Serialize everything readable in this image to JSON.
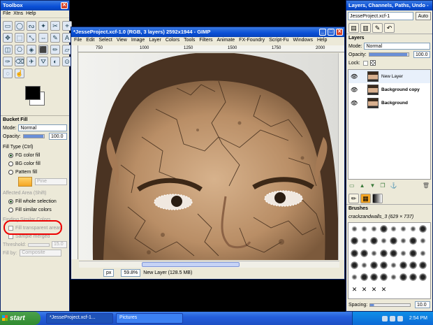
{
  "toolbox": {
    "title": "Toolbox",
    "menu": [
      "File",
      "Xtns",
      "Help"
    ],
    "tools": [
      "▭",
      "◯",
      "ᔓ",
      "✦",
      "✂",
      "⌖",
      "✥",
      "⬚",
      "⤡",
      "⇔",
      "✎",
      "A",
      "◫",
      "⎔",
      "◈",
      "⬛",
      "✏",
      "▱",
      "✑",
      "⌫",
      "✈",
      "⛛",
      "◐",
      "⊙",
      "◌",
      "☝"
    ],
    "tool_options_title": "Bucket Fill",
    "mode_label": "Mode:",
    "mode_value": "Normal",
    "opacity_label": "Opacity:",
    "opacity_value": "100.0",
    "fill_type_label": "Fill Type  (Ctrl)",
    "fill_fg": "FG color fill",
    "fill_bg": "BG color fill",
    "fill_pattern": "Pattern fill",
    "pattern_name": "Pine",
    "affected_area_label": "Affected Area  (Shift)",
    "fill_whole": "Fill whole selection",
    "fill_similar": "Fill similar colors",
    "finding_label": "Finding Similar Colors",
    "fill_transparent": "Fill transparent areas",
    "sample_merged": "Sample merged",
    "threshold_label": "Threshold:",
    "threshold_value": "15.0",
    "fill_by_label": "Fill by:",
    "fill_by_value": "Composite"
  },
  "image_window": {
    "title": "*JesseProject.xcf-1.0 (RGB, 3 layers) 2592x1944 - GIMP",
    "menu": [
      "File",
      "Edit",
      "Select",
      "View",
      "Image",
      "Layer",
      "Colors",
      "Tools",
      "Filters",
      "Animate",
      "FX-Foundry",
      "Script-Fu",
      "Windows",
      "Help"
    ],
    "ruler_ticks": [
      "750",
      "1000",
      "1250",
      "1500",
      "1750",
      "2000"
    ],
    "unit": "px",
    "zoom": "59.8%",
    "status": "New Layer (128.5 MB)"
  },
  "dock": {
    "title": "Layers, Channels, Paths, Undo -",
    "image_select": "JesseProject.xcf-1",
    "auto_label": "Auto",
    "layers_title": "Layers",
    "mode_label": "Mode:",
    "mode_value": "Normal",
    "opacity_label": "Opacity:",
    "opacity_value": "100.0",
    "lock_label": "Lock:",
    "layers": [
      "New Layer",
      "Background copy",
      "Background"
    ],
    "brushes_title": "Brushes",
    "brush_name": "crackzandwalls_3 (629 × 737)",
    "spacing_label": "Spacing:",
    "spacing_value": "10.0"
  },
  "taskbar": {
    "start": "start",
    "tasks": [
      "*JesseProject.xcf-1...",
      "Pictures"
    ],
    "clock": "2:54 PM"
  }
}
